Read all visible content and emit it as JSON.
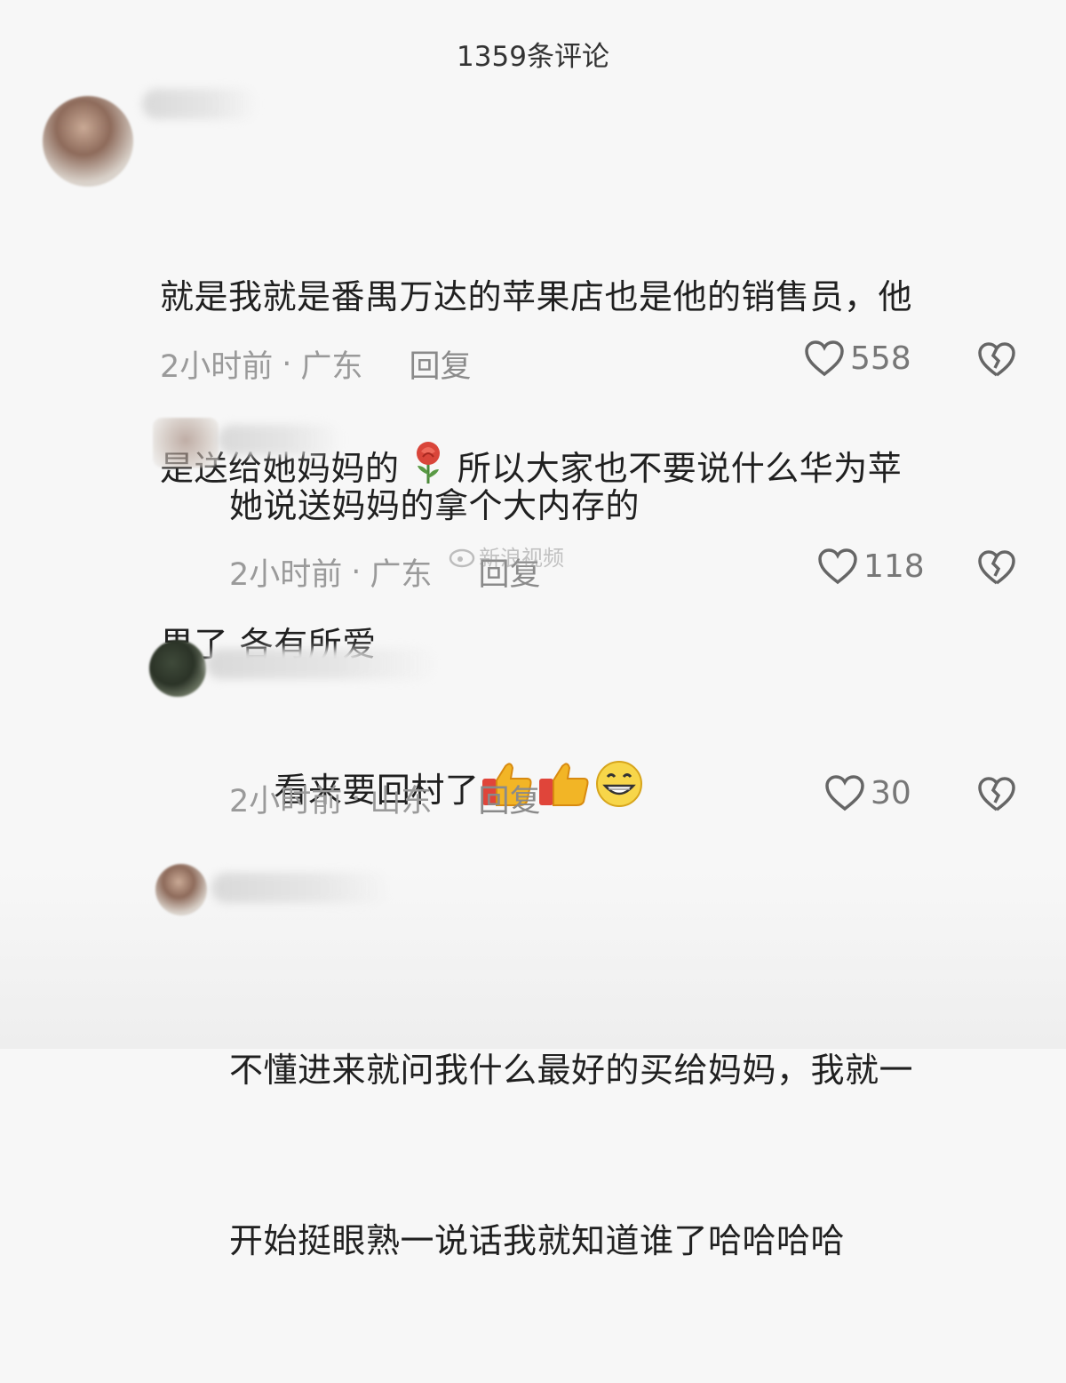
{
  "header": {
    "title": "1359条评论"
  },
  "comments": [
    {
      "text_line1": "就是我就是番禺万达的苹果店也是他的销售员，他",
      "text_line2a": "是送给她妈妈的",
      "text_line2b": "所以大家也不要说什么华为苹",
      "text_line3": "果了 各有所爱",
      "time": "2小时前",
      "dot": "·",
      "location": "广东",
      "reply": "回复",
      "likes": "558"
    },
    {
      "text": "她说送妈妈的拿个大内存的",
      "time": "2小时前",
      "dot": "·",
      "location": "广东",
      "reply": "回复",
      "likes": "118"
    },
    {
      "text": "看来要回村了",
      "time": "2小时前",
      "dot": "·",
      "location": "山东",
      "reply": "回复",
      "likes": "30"
    },
    {
      "text_line1": "不懂进来就问我什么最好的买给妈妈，我就一",
      "text_line2": "开始挺眼熟一说话我就知道谁了哈哈哈哈"
    }
  ],
  "watermark": {
    "text": "新浪视频"
  },
  "icons": {
    "like": "heart-outline-icon",
    "dislike": "broken-heart-icon",
    "rose": "rose-emoji",
    "thumbs": "thumbs-up-emoji",
    "grin": "grinning-face-emoji"
  },
  "colors": {
    "background": "#f7f7f7",
    "text": "#202020",
    "meta": "#9a9a9a"
  }
}
